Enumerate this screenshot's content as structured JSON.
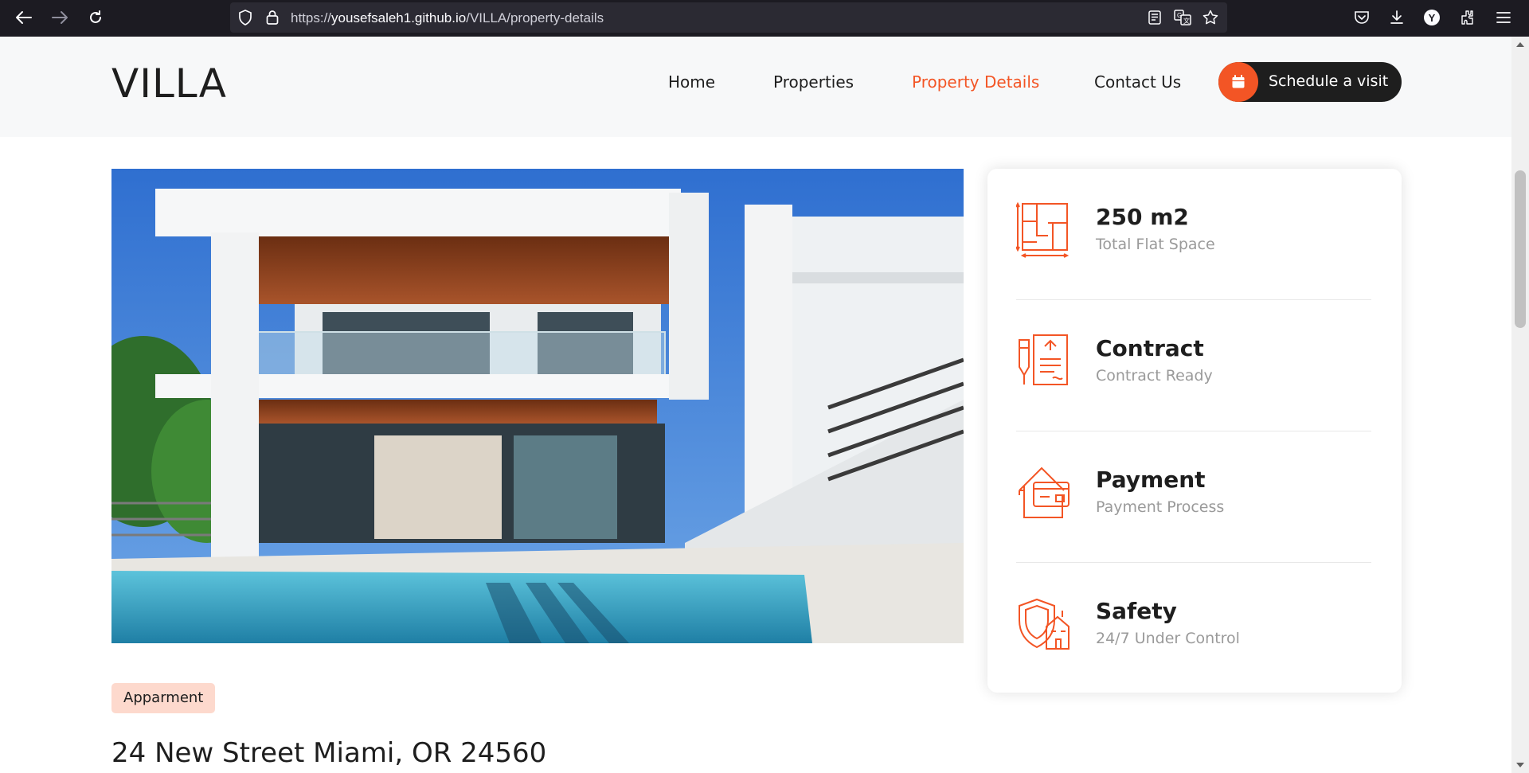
{
  "browser": {
    "url_prefix": "https://",
    "url_host": "yousefsaleh1.github.io",
    "url_path": "/VILLA/property-details",
    "profile_initial": "Y"
  },
  "site": {
    "logo": "VILLA",
    "nav": [
      {
        "label": "Home",
        "active": false
      },
      {
        "label": "Properties",
        "active": false
      },
      {
        "label": "Property Details",
        "active": true
      },
      {
        "label": "Contact Us",
        "active": false
      }
    ],
    "cta_label": "Schedule a visit",
    "accent_color": "#f35525"
  },
  "property": {
    "tag": "Apparment",
    "address": "24 New Street Miami, OR 24560",
    "features": [
      {
        "icon": "floor-plan-icon",
        "value": "250 m2",
        "label": "Total Flat Space"
      },
      {
        "icon": "contract-icon",
        "value": "Contract",
        "label": "Contract Ready"
      },
      {
        "icon": "payment-icon",
        "value": "Payment",
        "label": "Payment Process"
      },
      {
        "icon": "safety-shield-icon",
        "value": "Safety",
        "label": "24/7 Under Control"
      }
    ]
  }
}
